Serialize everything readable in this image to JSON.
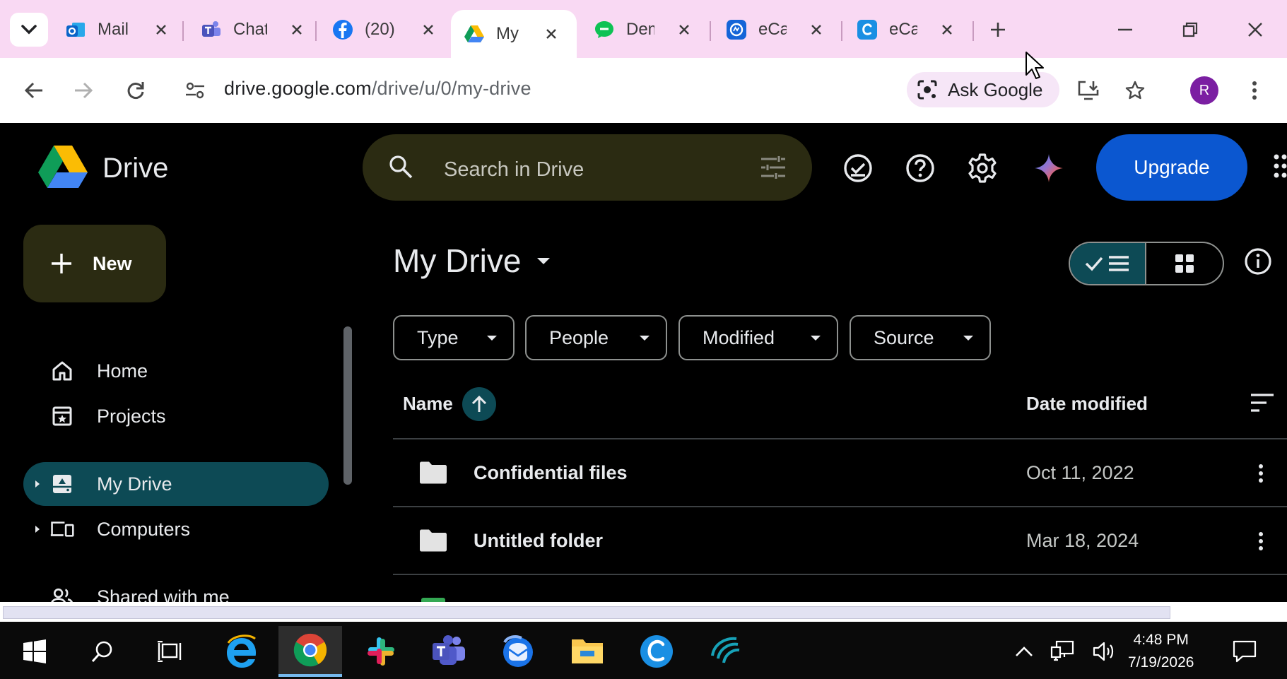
{
  "browser": {
    "tabs": [
      {
        "title": "Mail",
        "icon": "outlook-icon"
      },
      {
        "title": "Chat",
        "icon": "teams-icon"
      },
      {
        "title": "(20)",
        "icon": "facebook-icon"
      },
      {
        "title": "My Drive",
        "icon": "drive-icon",
        "active": true
      },
      {
        "title": "Dem",
        "icon": "chat-bubble-icon"
      },
      {
        "title": "eCa",
        "icon": "ecamm-icon"
      },
      {
        "title": "eCa",
        "icon": "ecare-icon"
      }
    ],
    "new_tab_label": "+",
    "address": {
      "host": "drive.google.com",
      "path": "/drive/u/0/my-drive"
    },
    "ask_google_label": "Ask Google",
    "profile_initial": "R"
  },
  "drive": {
    "brand": "Drive",
    "search_placeholder": "Search in Drive",
    "upgrade_label": "Upgrade",
    "new_label": "New",
    "nav": {
      "home": "Home",
      "projects": "Projects",
      "my_drive": "My Drive",
      "computers": "Computers",
      "shared": "Shared with me"
    },
    "page_title": "My Drive",
    "filters": {
      "type": "Type",
      "people": "People",
      "modified": "Modified",
      "source": "Source"
    },
    "columns": {
      "name": "Name",
      "date": "Date modified"
    },
    "rows": [
      {
        "name": "Confidential files",
        "date": "Oct 11, 2022"
      },
      {
        "name": "Untitled folder",
        "date": "Mar 18, 2024"
      }
    ]
  },
  "taskbar": {
    "time": "4:48 PM",
    "date": "7/19/2026"
  },
  "colors": {
    "tabstrip": "#f9d9f3",
    "accent_teal": "#0d4a55",
    "upgrade_blue": "#0b57d0",
    "search_bg": "#2b2b12"
  }
}
